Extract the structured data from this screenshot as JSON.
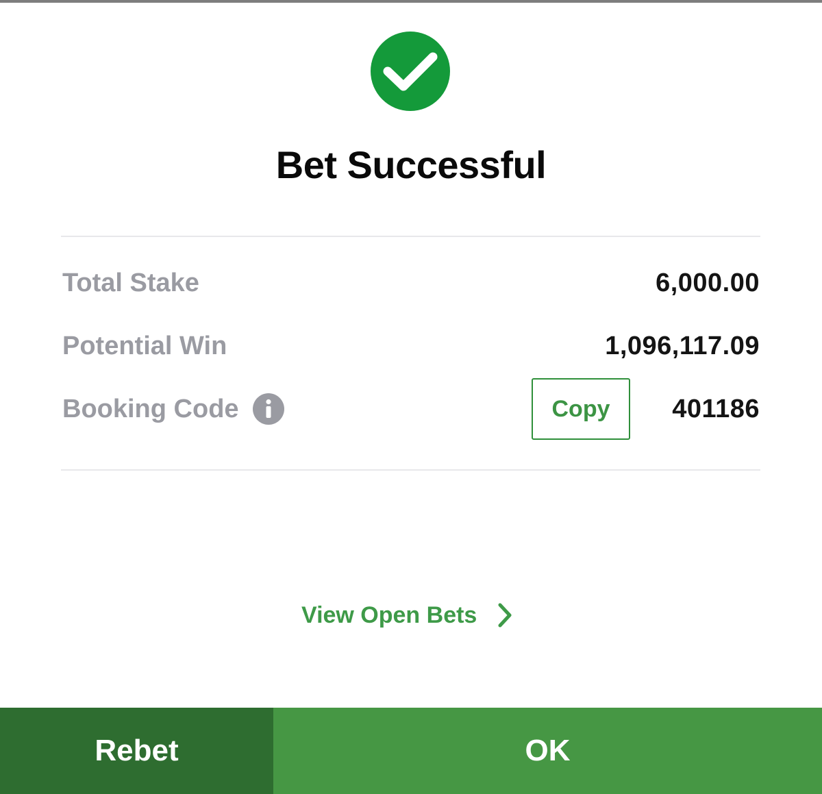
{
  "header": {
    "status_icon": "check-circle-icon",
    "title": "Bet Successful"
  },
  "summary": {
    "total_stake_label": "Total Stake",
    "total_stake_value": "6,000.00",
    "potential_win_label": "Potential Win",
    "potential_win_value": "1,096,117.09",
    "booking_code_label": "Booking Code",
    "booking_code_info_icon": "info-icon",
    "copy_label": "Copy",
    "booking_code_value": "401186"
  },
  "links": {
    "view_open_bets": "View Open Bets",
    "view_open_bets_icon": "chevron-right-icon"
  },
  "actions": {
    "rebet_label": "Rebet",
    "ok_label": "OK"
  },
  "colors": {
    "success_green": "#149a3a",
    "accent_green": "#3e9a48",
    "rebet_bg": "#2e6d30",
    "ok_bg": "#469744",
    "label_gray": "#9a9ba2"
  }
}
